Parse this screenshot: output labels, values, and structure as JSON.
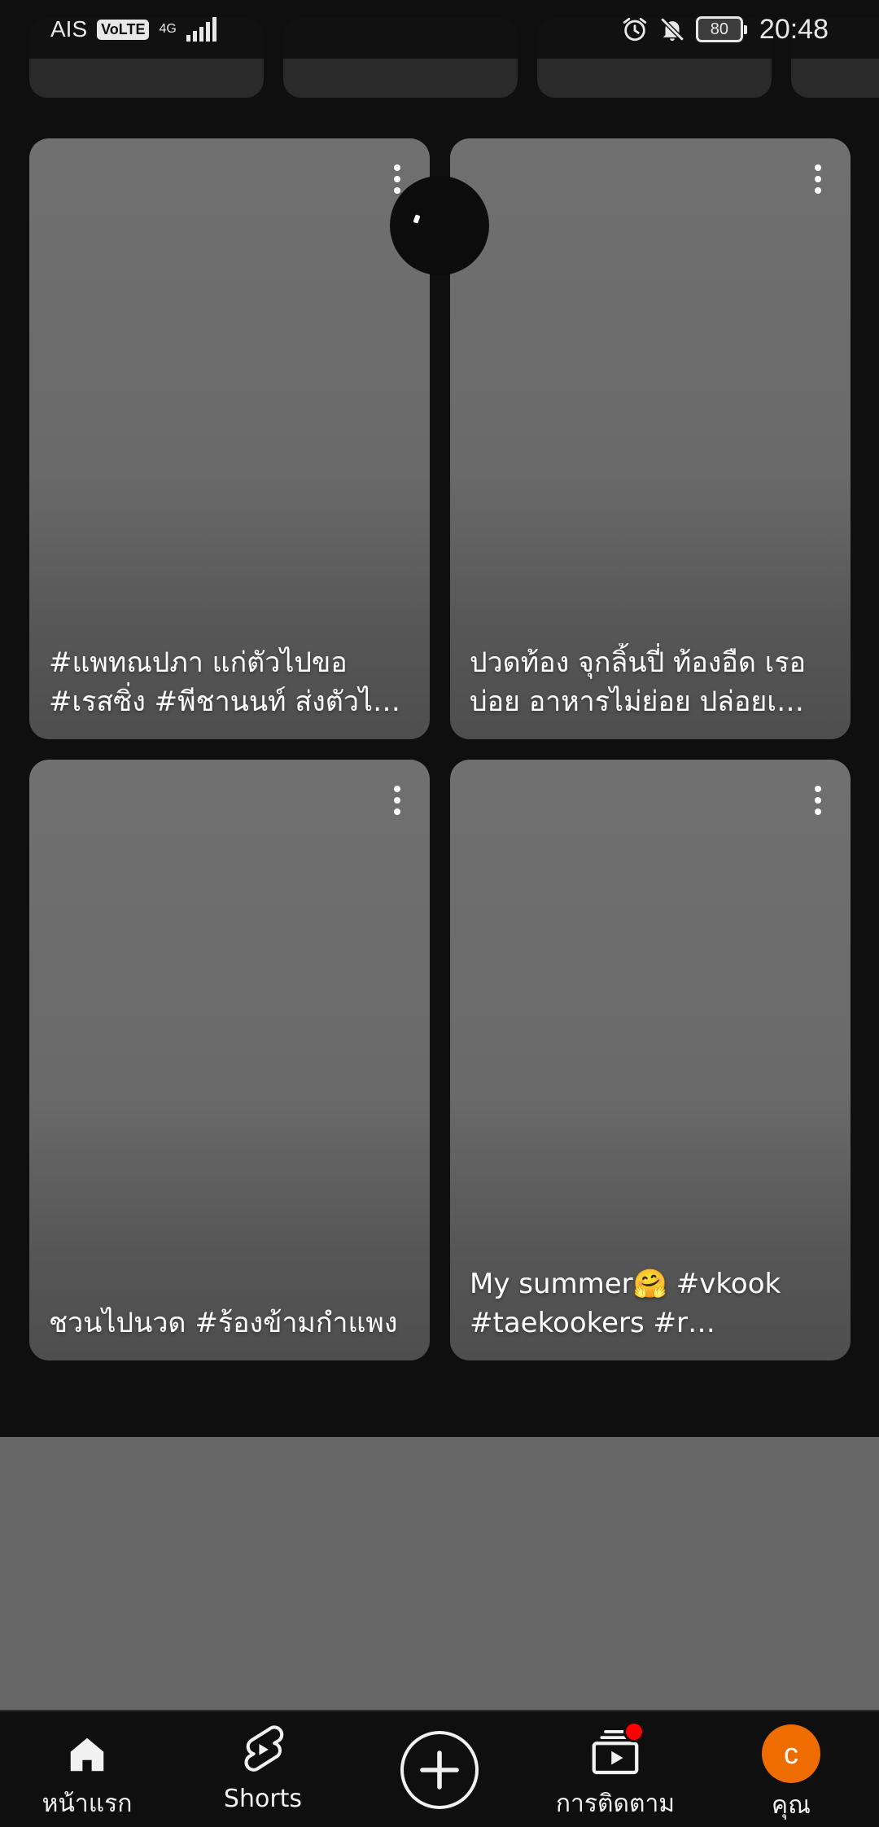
{
  "status_bar": {
    "carrier": "AIS",
    "volte": "VoLTE",
    "network": "4G",
    "battery": "80",
    "time": "20:48",
    "icons": [
      "alarm-icon",
      "bell-off-icon",
      "battery-icon",
      "signal-icon"
    ]
  },
  "chips": [
    "",
    "",
    "",
    ""
  ],
  "shorts": [
    {
      "title": "#แพทณปภา แก่ตัวไปขอ #เรสซิ่ง #พีชานนท์ ส่งตัวไ…"
    },
    {
      "title": "ปวดท้อง จุกลิ้นปี่ ท้องอืด เรอบ่อย อาหารไม่ย่อย ปล่อยเ…"
    },
    {
      "title": "ชวนไปนวด #ร้องข้ามกำแพง"
    },
    {
      "title": "My summer🤗 #vkook #taekookers #r…"
    }
  ],
  "nav": {
    "home": "หน้าแรก",
    "shorts": "Shorts",
    "subscriptions": "การติดตาม",
    "you": "คุณ",
    "avatar_letter": "c"
  },
  "colors": {
    "background": "#0f0f0f",
    "card": "#6a6a6a",
    "avatar": "#ef6c00",
    "badge": "#ff0000"
  }
}
